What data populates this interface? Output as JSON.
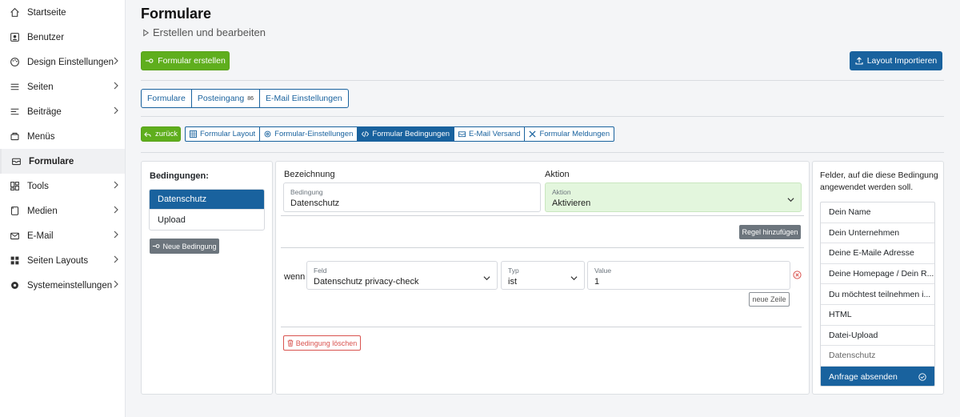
{
  "sidebar": {
    "items": [
      {
        "label": "Startseite",
        "icon": "home-icon",
        "chevron": false
      },
      {
        "label": "Benutzer",
        "icon": "user-icon",
        "chevron": false
      },
      {
        "label": "Design Einstellungen",
        "icon": "palette-icon",
        "chevron": true
      },
      {
        "label": "Seiten",
        "icon": "list-icon",
        "chevron": true
      },
      {
        "label": "Beiträge",
        "icon": "lines-icon",
        "chevron": true
      },
      {
        "label": "Menüs",
        "icon": "menu-icon",
        "chevron": false
      },
      {
        "label": "Formulare",
        "icon": "envelope-icon",
        "chevron": false,
        "active": true
      },
      {
        "label": "Tools",
        "icon": "grid-icon",
        "chevron": true
      },
      {
        "label": "Medien",
        "icon": "file-icon",
        "chevron": true
      },
      {
        "label": "E-Mail",
        "icon": "mail-icon",
        "chevron": true
      },
      {
        "label": "Seiten Layouts",
        "icon": "layout-icon",
        "chevron": true
      },
      {
        "label": "Systemeinstellungen",
        "icon": "gear-icon",
        "chevron": true
      }
    ]
  },
  "header": {
    "title": "Formulare",
    "subtitle": "Erstellen und bearbeiten",
    "create_button": "Formular erstellen",
    "import_button": "Layout Importieren"
  },
  "tabs": [
    {
      "label": "Formulare"
    },
    {
      "label": "Posteingang",
      "badge": "86"
    },
    {
      "label": "E-Mail Einstellungen"
    }
  ],
  "back_button": "zurück",
  "subtabs": [
    {
      "label": "Formular Layout",
      "icon": "table-icon"
    },
    {
      "label": "Formular-Einstellungen",
      "icon": "gear-icon"
    },
    {
      "label": "Formular Bedingungen",
      "icon": "code-icon",
      "active": true
    },
    {
      "label": "E-Mail Versand",
      "icon": "envelope-icon"
    },
    {
      "label": "Formular Meldungen",
      "icon": "tools-icon"
    }
  ],
  "conditions": {
    "heading": "Bedingungen:",
    "items": [
      {
        "label": "Datenschutz",
        "active": true
      },
      {
        "label": "Upload"
      }
    ],
    "new_button": "Neue Bedingung"
  },
  "editor": {
    "name_label": "Bezeichnung",
    "name_field_label": "Bedingung",
    "name_value": "Datenschutz",
    "action_label": "Aktion",
    "action_field_label": "Aktion",
    "action_value": "Aktivieren",
    "add_rule_button": "Regel hinzufügen",
    "rule": {
      "prefix": "wenn",
      "field_label": "Feld",
      "field_value": "Datenschutz privacy-check",
      "type_label": "Typ",
      "type_value": "ist",
      "value_label": "Value",
      "value_value": "1"
    },
    "new_row_button": "neue Zeile",
    "delete_button": "Bedingung löschen"
  },
  "fields_panel": {
    "title": "Felder, auf die diese Bedingung angewendet werden soll.",
    "items": [
      {
        "label": "Dein Name"
      },
      {
        "label": "Dein Unternehmen"
      },
      {
        "label": "Deine E-Maile Adresse"
      },
      {
        "label": "Deine Homepage / Dein R..."
      },
      {
        "label": "Du möchtest teilnehmen i..."
      },
      {
        "label": "HTML"
      },
      {
        "label": "Datei-Upload"
      },
      {
        "label": "Datenschutz",
        "muted": true
      },
      {
        "label": "Anfrage absenden",
        "active": true
      }
    ]
  },
  "colors": {
    "accent": "#19629e",
    "green": "#5fae1d",
    "danger": "#d9534f"
  }
}
